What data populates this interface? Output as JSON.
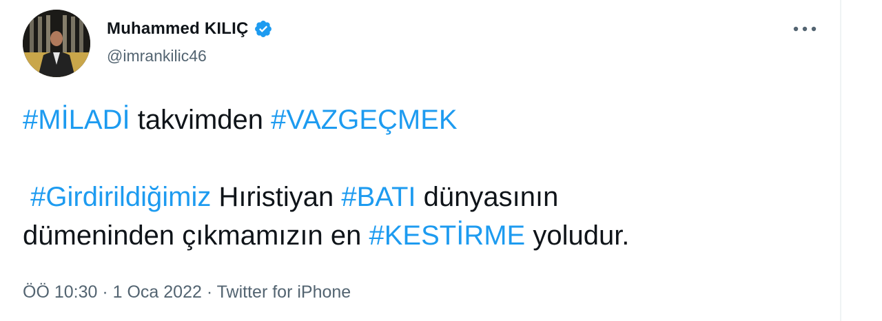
{
  "author": {
    "display_name": "Muhammed KILIÇ",
    "handle": "@imrankilic46",
    "verified": true
  },
  "tweet": {
    "line1": {
      "tag1": "#MİLADİ",
      "text1": " takvimden ",
      "tag2": "#VAZGEÇMEK"
    },
    "line2": {
      "lead": " ",
      "tag1": "#Girdirildiğimiz",
      "text1": " Hıristiyan ",
      "tag2": "#BATI",
      "text2": " dünyasının"
    },
    "line3": {
      "text1": "dümeninden çıkmamızın en ",
      "tag1": "#KESTİRME",
      "text2": " yoludur."
    }
  },
  "meta": {
    "time": "ÖÖ 10:30",
    "separator1": " · ",
    "date": "1 Oca 2022",
    "separator2": " · ",
    "source": "Twitter for iPhone"
  },
  "colors": {
    "link": "#1d9bf0",
    "text": "#0f1419",
    "secondary": "#536471"
  },
  "icons": {
    "verified": "verified-badge-icon",
    "more": "more-options-icon"
  }
}
